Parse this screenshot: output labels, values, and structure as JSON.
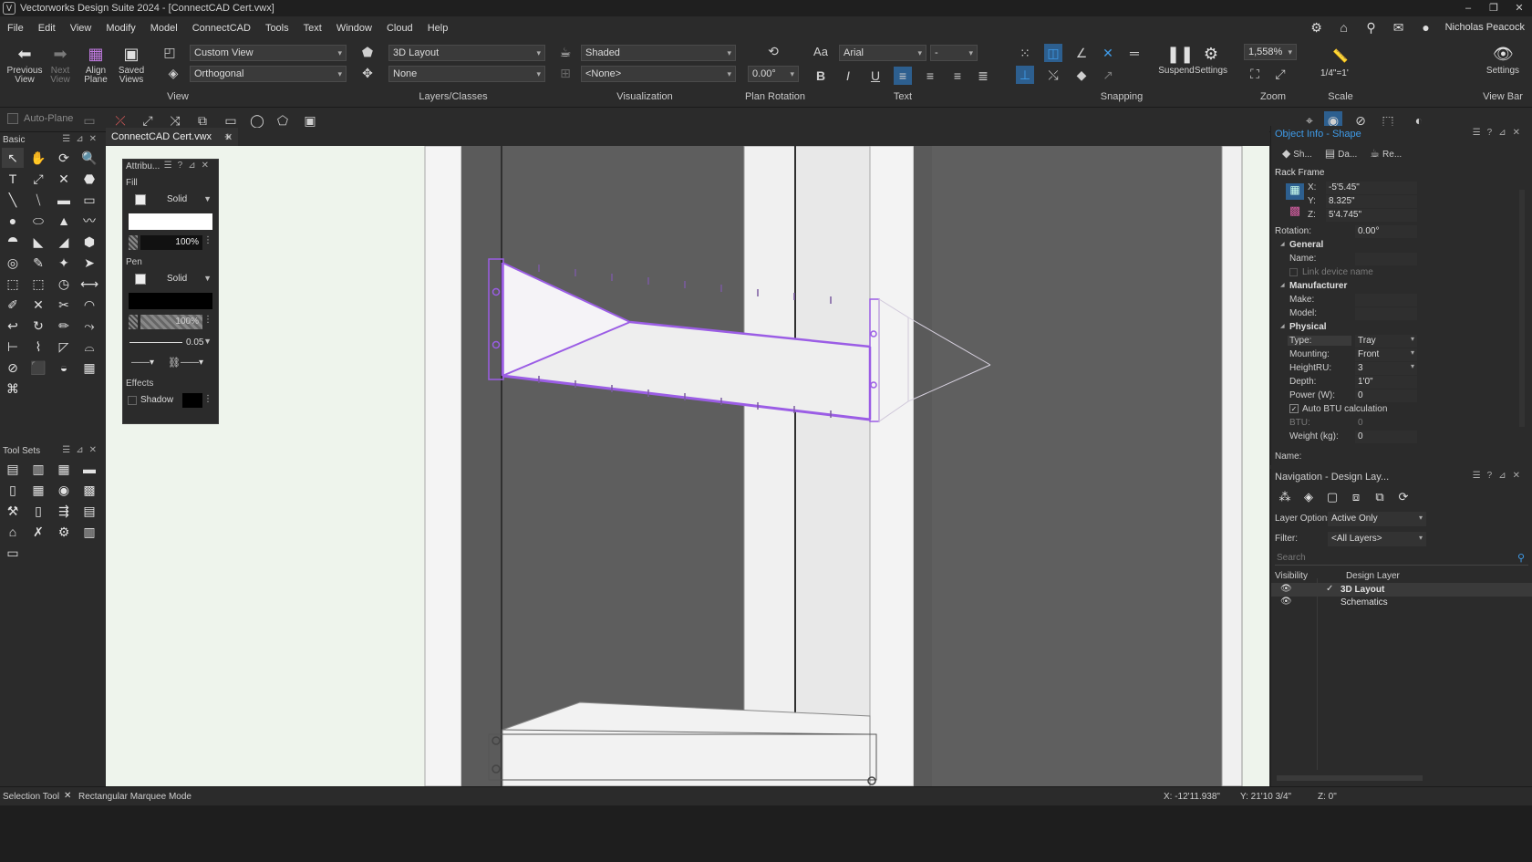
{
  "window": {
    "title": "Vectorworks Design Suite 2024 - [ConnectCAD Cert.vwx]",
    "app_icon": "V",
    "controls": [
      "–",
      "❐",
      "✕"
    ]
  },
  "menu": {
    "items": [
      "File",
      "Edit",
      "View",
      "Modify",
      "Model",
      "ConnectCAD",
      "Tools",
      "Text",
      "Window",
      "Cloud",
      "Help"
    ],
    "user": "Nicholas Peacock"
  },
  "ribbon": {
    "view": {
      "label": "View",
      "previous": "Previous View",
      "next": "Next View",
      "align": "Align Plane",
      "saved": "Saved Views",
      "view_combo": "Custom View",
      "projection_combo": "Orthogonal"
    },
    "layers": {
      "label": "Layers/Classes",
      "layer_combo": "3D Layout",
      "class_combo": "None"
    },
    "visualization": {
      "label": "Visualization",
      "render_combo": "Shaded",
      "mode_combo": "<None>"
    },
    "plan_rotation": {
      "label": "Plan Rotation",
      "value": "0.00°"
    },
    "text": {
      "label": "Text",
      "font": "Arial",
      "size": "-"
    },
    "snapping": {
      "label": "Snapping",
      "suspend": "Suspend",
      "settings": "Settings"
    },
    "zoom": {
      "label": "Zoom",
      "value": "1,558%"
    },
    "scale": {
      "label": "Scale",
      "value": "1/4\"=1'"
    },
    "viewbar": {
      "label": "View Bar",
      "settings": "Settings"
    }
  },
  "toolbar2": {
    "auto_plane": "Auto-Plane"
  },
  "doc": {
    "tab_label": "ConnectCAD Cert.vwx",
    "close": "✕",
    "add": "+"
  },
  "basic_palette": {
    "title": "Basic",
    "tools": [
      "↖",
      "✋",
      "⟳",
      "🔍",
      "T",
      "⤢",
      "✕",
      "⬣",
      "╲",
      "⧹",
      "▬",
      "▭",
      "●",
      "⬭",
      "▲",
      "〰",
      "⯊",
      "◣",
      "◢",
      "⬢",
      "◎",
      "✎",
      "✦",
      "➤",
      "⬚",
      "⬚",
      "◷",
      "⟷",
      "✐",
      "✕",
      "✂",
      "◠",
      "↩",
      "↻",
      "✏",
      "⤳",
      "⊢",
      "⌇",
      "◸",
      "⌓",
      "⊘",
      "⬛",
      "◒",
      "▦",
      "⌘"
    ]
  },
  "toolsets": {
    "title": "Tool Sets",
    "icons": [
      "▤",
      "▥",
      "▦",
      "▬",
      "▯",
      "▦",
      "◉",
      "▩",
      "⚒",
      "▯",
      "⇶",
      "▤",
      "⌂",
      "✗",
      "⚙",
      "▥",
      "▭"
    ]
  },
  "attributes": {
    "title": "Attribu...",
    "fill_label": "Fill",
    "fill_style": "Solid",
    "fill_opacity": "100%",
    "pen_label": "Pen",
    "pen_style": "Solid",
    "pen_opacity": "100%",
    "line_weight": "0.05",
    "effects_label": "Effects",
    "shadow_label": "Shadow"
  },
  "object_info": {
    "title": "Object Info - Shape",
    "tabs": [
      "Sh...",
      "Da...",
      "Re..."
    ],
    "object_type": "Rack Frame",
    "x": "-5'5.45\"",
    "y": "8.325\"",
    "z": "5'4.745\"",
    "rotation_label": "Rotation:",
    "rotation": "0.00°",
    "general": "General",
    "name_label": "Name:",
    "link_device": "Link device name",
    "manufacturer": "Manufacturer",
    "make_label": "Make:",
    "model_label": "Model:",
    "physical": "Physical",
    "type_label": "Type:",
    "type": "Tray",
    "mounting_label": "Mounting:",
    "mounting": "Front",
    "height_label": "HeightRU:",
    "height": "3",
    "depth_label": "Depth:",
    "depth": "1'0\"",
    "power_label": "Power (W):",
    "power": "0",
    "auto_btu": "Auto BTU calculation",
    "btu_label": "BTU:",
    "btu": "0",
    "weight_label": "Weight (kg):",
    "weight": "0",
    "name_footer": "Name:"
  },
  "navigation": {
    "title": "Navigation - Design Lay...",
    "layer_options_label": "Layer Options:",
    "layer_options": "Active Only",
    "filter_label": "Filter:",
    "filter": "<All Layers>",
    "search_placeholder": "Search",
    "col_visibility": "Visibility",
    "col_layer": "Design Layer",
    "layers": [
      "3D Layout",
      "Schematics"
    ]
  },
  "status": {
    "tool": "Selection Tool",
    "mode": "Rectangular Marquee Mode",
    "x": "X: -12'11.938\"",
    "y": "Y: 21'10 3/4\"",
    "z": "Z: 0\""
  },
  "colors": {
    "accent": "#3f9be8",
    "selection": "#9b5de5",
    "canvas_bg": "#eef4ec"
  }
}
